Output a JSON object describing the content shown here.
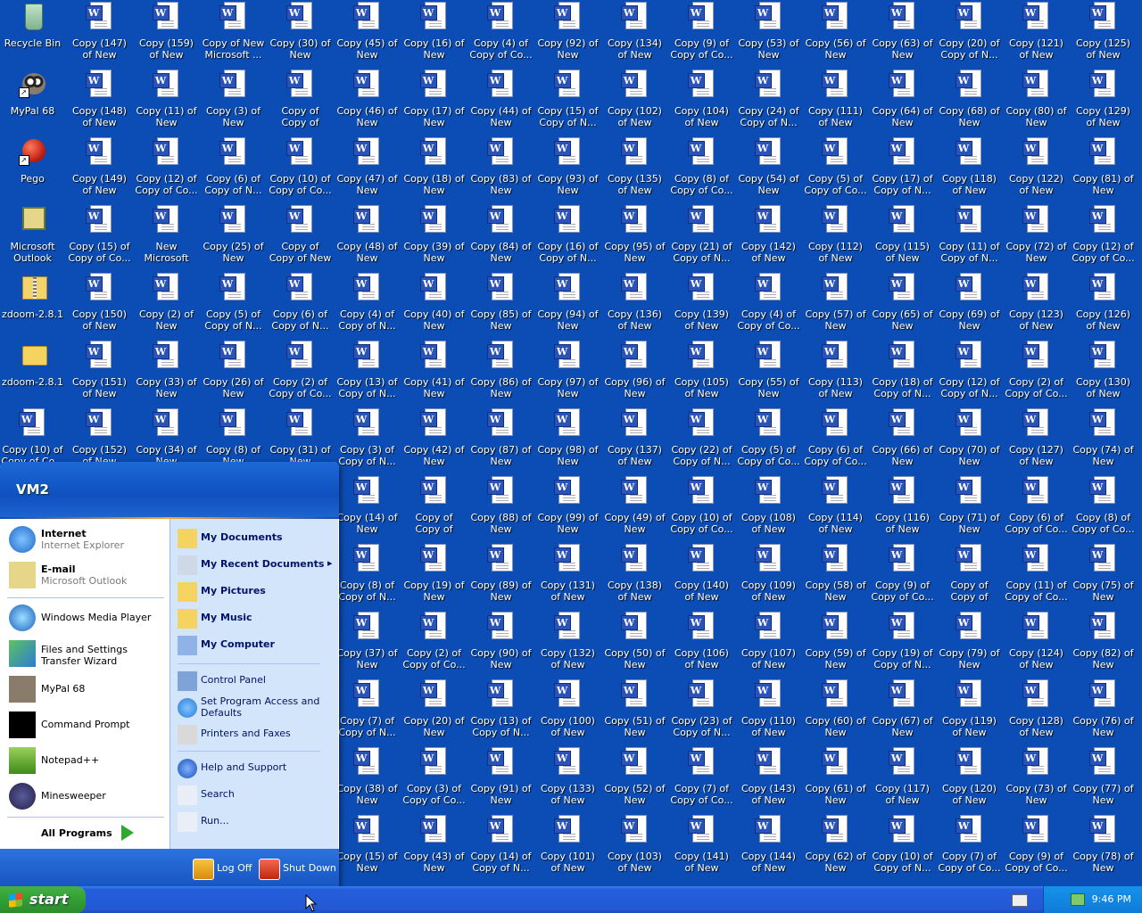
{
  "desktop": {
    "color": "#0b4db4",
    "system_icons": [
      {
        "label": "Recycle Bin",
        "icon": "recycle-bin-icon"
      },
      {
        "label": "MyPal 68",
        "icon": "mypal-icon"
      },
      {
        "label": "Pego",
        "icon": "pego-icon"
      },
      {
        "label": "Microsoft Outlook",
        "icon": "outlook-icon"
      },
      {
        "label": "zdoom-2.8.1",
        "icon": "zip-folder-icon"
      },
      {
        "label": "zdoom-2.8.1",
        "icon": "folder-icon"
      }
    ],
    "doc_columns": [
      [
        "Copy (147) of New Micros...",
        "Copy (148) of New Micros...",
        "Copy (149) of New Micros...",
        "Copy (15) of Copy of Co...",
        "Copy (150) of New Micros...",
        "Copy (151) of New Micros...",
        "Copy (152) of New Micros..."
      ],
      [
        "Copy (159) of New Micros...",
        "Copy (11) of New Micros...",
        "Copy (12) of Copy of Co...",
        "New Microsoft Word Docu...",
        "Copy (2) of New Micros...",
        "Copy (33) of New Micros...",
        "Copy (34) of New Micros..."
      ],
      [
        "Copy of New Microsoft ...",
        "Copy (3) of New Micros...",
        "Copy (6) of Copy of N...",
        "Copy (25) of New Micros...",
        "Copy (5) of Copy of N...",
        "Copy (26) of New Micros...",
        "Copy (8) of New Micros..."
      ],
      [
        "Copy (30) of New Micros...",
        "Copy of Copy of Copy of ...",
        "Copy (10) of Copy of Co...",
        "Copy of Copy of New Mic...",
        "Copy (6) of Copy of N...",
        "Copy (2) of Copy of Co...",
        "Copy (31) of New Micros..."
      ],
      [
        "Copy (45) of New Micros...",
        "Copy (46) of New Micros...",
        "Copy (47) of New Micros...",
        "Copy (48) of New Micros...",
        "Copy (4) of Copy of N...",
        "Copy (13) of Copy of N...",
        "Copy (3) of Copy of N...",
        "Copy (14) of New Micros...",
        "Copy (8) of Copy of N...",
        "Copy (37) of New Micros...",
        "Copy (7) of Copy of N...",
        "Copy (38) of New Micros...",
        "Copy (15) of New Micros..."
      ],
      [
        "Copy (16) of New Micros...",
        "Copy (17) of New Micros...",
        "Copy (18) of New Micros...",
        "Copy (39) of New Micros...",
        "Copy (40) of New Micros...",
        "Copy (41) of New Micros...",
        "Copy (42) of New Micros...",
        "Copy of Copy of Copy of ...",
        "Copy (19) of New Micros...",
        "Copy (2) of Copy of Co...",
        "Copy (20) of New Micros...",
        "Copy (3) of Copy of Co...",
        "Copy (43) of New Micros..."
      ],
      [
        "Copy (4) of Copy of Co...",
        "Copy (44) of New Micros...",
        "Copy (83) of New Micros...",
        "Copy (84) of New Micros...",
        "Copy (85) of New Micros...",
        "Copy (86) of New Micros...",
        "Copy (87) of New Micros...",
        "Copy (88) of New Micros...",
        "Copy (89) of New Micros...",
        "Copy (90) of New Micros...",
        "Copy (13) of Copy of N...",
        "Copy (91) of New Micros...",
        "Copy (14) of Copy of N..."
      ],
      [
        "Copy (92) of New Micros...",
        "Copy (15) of Copy of N...",
        "Copy (93) of New Micros...",
        "Copy (16) of Copy of N...",
        "Copy (94) of New Micros...",
        "Copy (97) of New Micros...",
        "Copy (98) of New Micros...",
        "Copy (99) of New Micros...",
        "Copy (131) of New Micros...",
        "Copy (132) of New Micros...",
        "Copy (100) of New Micros...",
        "Copy (133) of New Micros...",
        "Copy (101) of New Micros..."
      ],
      [
        "Copy (134) of New Micros...",
        "Copy (102) of New Micros...",
        "Copy (135) of New Micros...",
        "Copy (95) of New Micros...",
        "Copy (136) of New Micros...",
        "Copy (96) of New Micros...",
        "Copy (137) of New Micros...",
        "Copy (49) of New Micros...",
        "Copy (138) of New Micros...",
        "Copy (50) of New Micros...",
        "Copy (51) of New Micros...",
        "Copy (52) of New Micros...",
        "Copy (103) of New Micros..."
      ],
      [
        "Copy (9) of Copy of Co...",
        "Copy (104) of New Micros...",
        "Copy (8) of Copy of Co...",
        "Copy (21) of Copy of N...",
        "Copy (139) of New Micros...",
        "Copy (105) of New Micros...",
        "Copy (22) of Copy of N...",
        "Copy (10) of Copy of Co...",
        "Copy (140) of New Micros...",
        "Copy (106) of New Micros...",
        "Copy (23) of Copy of N...",
        "Copy (7) of Copy of Co...",
        "Copy (141) of New Micros..."
      ],
      [
        "Copy (53) of New Micros...",
        "Copy (24) of Copy of N...",
        "Copy (54) of New Micros...",
        "Copy (142) of New Micros...",
        "Copy (4) of Copy of Co...",
        "Copy (55) of New Micros...",
        "Copy (5) of Copy of Co...",
        "Copy (108) of New Micros...",
        "Copy (109) of New Micros...",
        "Copy (107) of New Micros...",
        "Copy (110) of New Micros...",
        "Copy (143) of New Micros...",
        "Copy (144) of New Micros..."
      ],
      [
        "Copy (56) of New Micros...",
        "Copy (111) of New Micros...",
        "Copy (5) of Copy of Co...",
        "Copy (112) of New Micros...",
        "Copy (57) of New Micros...",
        "Copy (113) of New Micros...",
        "Copy (6) of Copy of Co...",
        "Copy (114) of New Micros...",
        "Copy (58) of New Micros...",
        "Copy (59) of New Micros...",
        "Copy (60) of New Micros...",
        "Copy (61) of New Micros...",
        "Copy (62) of New Micros..."
      ],
      [
        "Copy (63) of New Micros...",
        "Copy (64) of New Micros...",
        "Copy (17) of Copy of N...",
        "Copy (115) of New Micros...",
        "Copy (65) of New Micros...",
        "Copy (18) of Copy of N...",
        "Copy (66) of New Micros...",
        "Copy (116) of New Micros...",
        "Copy (9) of Copy of Co...",
        "Copy (19) of Copy of N...",
        "Copy (67) of New Micros...",
        "Copy (117) of New Micros...",
        "Copy (10) of Copy of N..."
      ],
      [
        "Copy (20) of Copy of N...",
        "Copy (68) of New Micros...",
        "Copy (118) of New Micros...",
        "Copy (11) of Copy of N...",
        "Copy (69) of New Micros...",
        "Copy (12) of Copy of N...",
        "Copy (70) of New Micros...",
        "Copy (71) of New Micros...",
        "Copy of Copy of Copy of ...",
        "Copy (79) of New Micros...",
        "Copy (119) of New Micros...",
        "Copy (120) of New Micros...",
        "Copy (7) of Copy of Co..."
      ],
      [
        "Copy (121) of New Micros...",
        "Copy (80) of New Micros...",
        "Copy (122) of New Micros...",
        "Copy (72) of New Micros...",
        "Copy (123) of New Micros...",
        "Copy (2) of Copy of Co...",
        "Copy (127) of New Micros...",
        "Copy (6) of Copy of Co...",
        "Copy (11) of Copy of Co...",
        "Copy (124) of New Micros...",
        "Copy (128) of New Micros...",
        "Copy (73) of New Micros...",
        "Copy (9) of Copy of Co..."
      ],
      [
        "Copy (125) of New Micros...",
        "Copy (129) of New Micros...",
        "Copy (81) of New Micros...",
        "Copy (12) of Copy of Co...",
        "Copy (126) of New Micros...",
        "Copy (130) of New Micros...",
        "Copy (74) of New Micros...",
        "Copy (8) of Copy of Co...",
        "Copy (75) of New Micros...",
        "Copy (82) of New Micros...",
        "Copy (76) of New Micros...",
        "Copy (77) of New Micros...",
        "Copy (78) of New Micros..."
      ]
    ],
    "extra_col0": [
      "Copy (10) of Copy of Co..."
    ]
  },
  "start_menu": {
    "user": "VM2",
    "left_pinned": [
      {
        "title": "Internet",
        "sub": "Internet Explorer",
        "icon": "internet-explorer-icon"
      },
      {
        "title": "E-mail",
        "sub": "Microsoft Outlook",
        "icon": "outlook-icon"
      }
    ],
    "left_recent": [
      {
        "title": "Windows Media Player",
        "icon": "media-player-icon"
      },
      {
        "title": "Files and Settings Transfer Wizard",
        "icon": "transfer-wizard-icon"
      },
      {
        "title": "MyPal 68",
        "icon": "mypal-icon"
      },
      {
        "title": "Command Prompt",
        "icon": "command-prompt-icon"
      },
      {
        "title": "Notepad++",
        "icon": "notepad-icon"
      },
      {
        "title": "Minesweeper",
        "icon": "minesweeper-icon"
      }
    ],
    "all_programs": "All Programs",
    "right_places": [
      {
        "title": "My Documents",
        "icon": "my-documents-icon",
        "bold": true
      },
      {
        "title": "My Recent Documents",
        "icon": "recent-documents-icon",
        "bold": true,
        "arrow": "▸"
      },
      {
        "title": "My Pictures",
        "icon": "my-pictures-icon",
        "bold": true
      },
      {
        "title": "My Music",
        "icon": "my-music-icon",
        "bold": true
      },
      {
        "title": "My Computer",
        "icon": "my-computer-icon",
        "bold": true
      }
    ],
    "right_system": [
      {
        "title": "Control Panel",
        "icon": "control-panel-icon"
      },
      {
        "title": "Set Program Access and Defaults",
        "icon": "program-access-icon"
      },
      {
        "title": "Printers and Faxes",
        "icon": "printer-icon"
      }
    ],
    "right_help": [
      {
        "title": "Help and Support",
        "icon": "help-icon"
      },
      {
        "title": "Search",
        "icon": "search-icon"
      },
      {
        "title": "Run...",
        "icon": "run-icon"
      }
    ],
    "log_off": "Log Off",
    "shut_down": "Shut Down"
  },
  "taskbar": {
    "start_label": "start",
    "clock": "9:46 PM"
  }
}
